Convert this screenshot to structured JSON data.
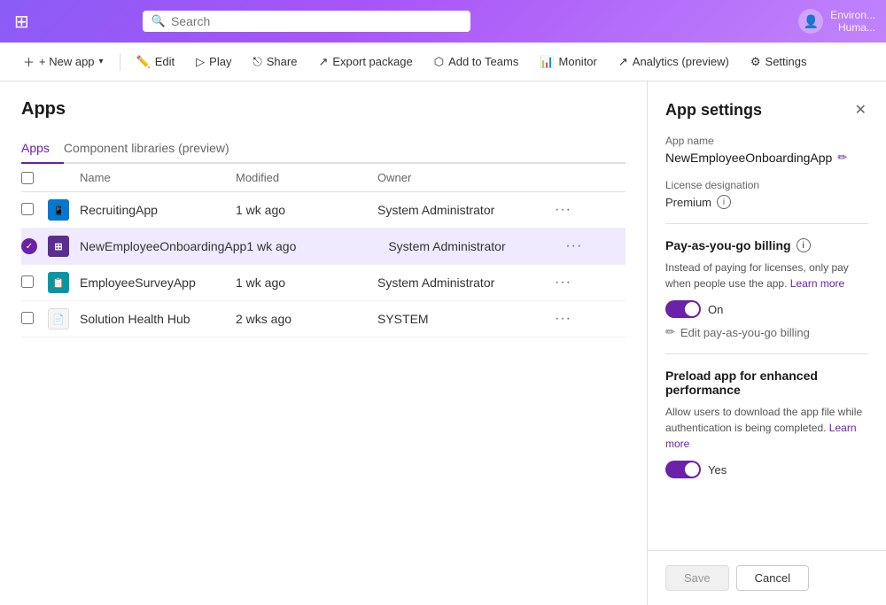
{
  "topbar": {
    "search_placeholder": "Search",
    "env_name": "Environ...",
    "user_name": "Huma..."
  },
  "toolbar": {
    "new_app": "+ New app",
    "edit": "Edit",
    "play": "Play",
    "share": "Share",
    "export_package": "Export package",
    "add_to_teams": "Add to Teams",
    "monitor": "Monitor",
    "analytics": "Analytics (preview)",
    "settings": "Settings"
  },
  "page": {
    "title": "Apps",
    "tabs": [
      "Apps",
      "Component libraries (preview)"
    ],
    "active_tab": 0
  },
  "table": {
    "columns": [
      "",
      "",
      "Name",
      "Modified",
      "Owner",
      ""
    ],
    "rows": [
      {
        "id": 1,
        "icon_type": "blue",
        "icon_label": "R",
        "name": "RecruitingApp",
        "modified": "1 wk ago",
        "owner": "System Administrator",
        "selected": false,
        "checked": false
      },
      {
        "id": 2,
        "icon_type": "purple",
        "icon_label": "N",
        "name": "NewEmployeeOnboardingApp",
        "modified": "1 wk ago",
        "owner": "System Administrator",
        "selected": true,
        "checked": true
      },
      {
        "id": 3,
        "icon_type": "teal",
        "icon_label": "E",
        "name": "EmployeeSurveyApp",
        "modified": "1 wk ago",
        "owner": "System Administrator",
        "selected": false,
        "checked": false
      },
      {
        "id": 4,
        "icon_type": "doc",
        "icon_label": "S",
        "name": "Solution Health Hub",
        "modified": "2 wks ago",
        "owner": "SYSTEM",
        "selected": false,
        "checked": false
      }
    ]
  },
  "app_settings": {
    "title": "App settings",
    "app_name_label": "App name",
    "app_name_value": "NewEmployeeOnboardingApp",
    "license_label": "License designation",
    "license_value": "Premium",
    "pay_as_you_go_label": "Pay-as-you-go billing",
    "pay_as_you_go_desc": "Instead of paying for licenses, only pay when people use the app.",
    "learn_more_billing": "Learn more",
    "toggle_on_label": "On",
    "toggle_on_state": true,
    "edit_billing_label": "Edit pay-as-you-go billing",
    "preload_label": "Preload app for enhanced performance",
    "preload_desc": "Allow users to download the app file while authentication is being completed.",
    "learn_more_preload": "Learn more",
    "toggle_yes_label": "Yes",
    "toggle_yes_state": true,
    "save_btn": "Save",
    "cancel_btn": "Cancel"
  }
}
